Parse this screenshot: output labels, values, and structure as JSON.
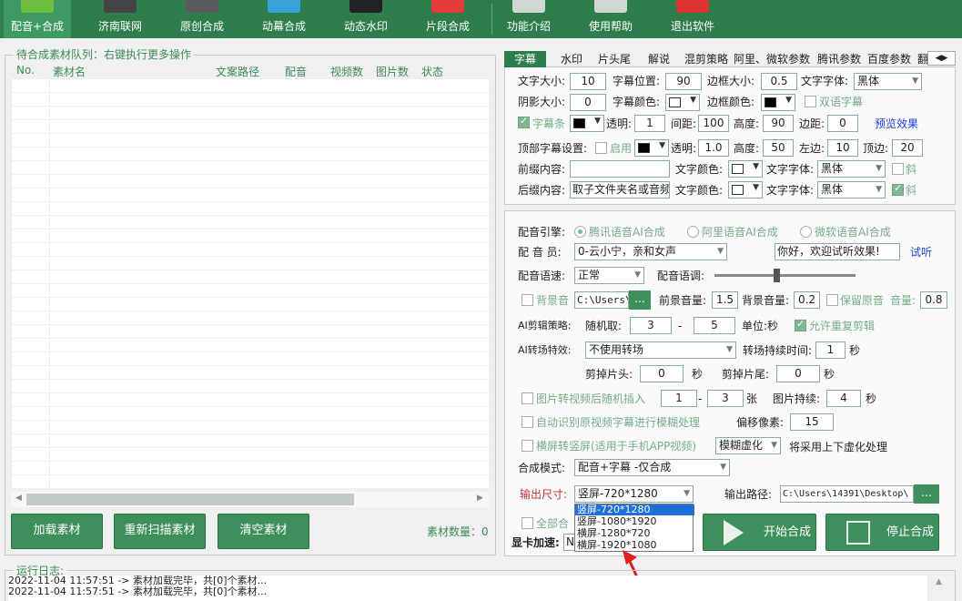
{
  "toolbar": {
    "items": [
      {
        "label": "配音+合成"
      },
      {
        "label": "济南联网"
      },
      {
        "label": "原创合成"
      },
      {
        "label": "动幕合成"
      },
      {
        "label": "动态水印"
      },
      {
        "label": "片段合成"
      },
      {
        "label": "功能介绍"
      },
      {
        "label": "使用帮助"
      },
      {
        "label": "退出软件"
      }
    ]
  },
  "queue": {
    "legend": "待合成素材队列：右键执行更多操作",
    "columns": [
      "No.",
      "素材名",
      "文案路径",
      "配音",
      "视频数",
      "图片数",
      "状态"
    ],
    "buttons": {
      "load": "加载素材",
      "rescan": "重新扫描素材",
      "clear": "清空素材"
    },
    "count_label": "素材数量：0"
  },
  "tabs": [
    "字幕",
    "水印",
    "片头尾",
    "解说",
    "混剪策略",
    "阿里、微软参数",
    "腾讯参数",
    "百度参数",
    "翻"
  ],
  "subtitle": {
    "font_size_label": "文字大小:",
    "font_size": "10",
    "position_label": "字幕位置:",
    "position": "90",
    "border_size_label": "边框大小:",
    "border_size": "0.5",
    "font_label": "文字字体:",
    "font": "黑体",
    "shadow_label": "阴影大小:",
    "shadow": "0",
    "color_label": "字幕颜色:",
    "border_color_label": "边框颜色:",
    "bilingual_label": "双语字幕",
    "bar_label": "字幕条",
    "alpha_label": "透明:",
    "alpha": "1",
    "spacing_label": "间距:",
    "spacing": "100",
    "height_label": "高度:",
    "height": "90",
    "margin_label": "边距:",
    "margin": "0",
    "preview_link": "预览效果",
    "top_label": "顶部字幕设置:",
    "top_enable": "启用",
    "top_alpha_label": "透明:",
    "top_alpha": "1.0",
    "top_height_label": "高度:",
    "top_height": "50",
    "top_left_label": "左边:",
    "top_left": "10",
    "top_top_label": "顶边:",
    "top_top": "20",
    "prefix_label": "前缀内容:",
    "prefix": "",
    "text_color_label": "文字颜色:",
    "text_font_label": "文字字体:",
    "text_font": "黑体",
    "italic": "斜",
    "suffix_label": "后缀内容:",
    "suffix": "取子文件夹名或音频"
  },
  "dubbing": {
    "engine_label": "配音引擎:",
    "engines": [
      "腾讯语音AI合成",
      "阿里语音AI合成",
      "微软语音AI合成"
    ],
    "voice_label": "配 音 员:",
    "voice": "0-云小宁，亲和女声",
    "test_text": "你好，欢迎试听效果!",
    "test_link": "试听",
    "speed_label": "配音语速:",
    "speed": "正常",
    "pitch_label": "配音语调:",
    "pitch_level": 0.44,
    "bgm_label": "背景音",
    "bgm_path": "C:\\Users\\",
    "browse": "...",
    "fg_vol_label": "前景音量:",
    "fg_vol": "1.5",
    "bg_vol_label": "背景音量:",
    "bg_vol": "0.2",
    "keep_orig_label": "保留原音",
    "vol_label": "音量:",
    "vol": "0.8",
    "cut_label": "AI剪辑策略:",
    "cut_random": "随机取:",
    "cut_min": "3",
    "cut_dash": "-",
    "cut_max": "5",
    "cut_unit": "单位:秒",
    "repeat_label": "允许重复剪辑",
    "trans_label": "AI转场特效:",
    "trans": "不使用转场",
    "trans_dur_label": "转场持续时间:",
    "trans_dur": "1",
    "sec": "秒",
    "head_label": "剪掉片头:",
    "head": "0",
    "tail_label": "剪掉片尾:",
    "tail": "0",
    "img_insert_label": "图片转视频后随机插入",
    "img_min": "1",
    "img_max": "3",
    "img_unit": "张",
    "img_dur_label": "图片持续:",
    "img_dur": "4",
    "blur_label": "自动识别原视频字幕进行模糊处理",
    "offset_label": "偏移像素:",
    "offset": "15",
    "portrait_label": "横屏转竖屏(适用于手机APP视频)",
    "portrait_mode": "模糊虚化",
    "portrait_note": "将采用上下虚化处理",
    "mode_label": "合成模式:",
    "mode": "配音+字幕 -仅合成",
    "size_label": "输出尺寸:",
    "size": "竖屏-720*1280",
    "size_options": [
      "竖屏-720*1280",
      "竖屏-1080*1920",
      "横屏-1280*720",
      "横屏-1920*1080"
    ],
    "out_label": "输出路径:",
    "out_path": "C:\\Users\\14391\\Desktop\\",
    "all_label": "全部合",
    "gpu_label": "显卡加速:",
    "gpu": "N",
    "start": "开始合成",
    "stop": "停止合成"
  },
  "log": {
    "legend": "运行日志:",
    "lines": [
      "2022-11-04 11:57:51 -> 素材加载完毕，共[0]个素材...",
      "2022-11-04 11:57:51 -> 素材加载完毕，共[0]个素材..."
    ]
  }
}
